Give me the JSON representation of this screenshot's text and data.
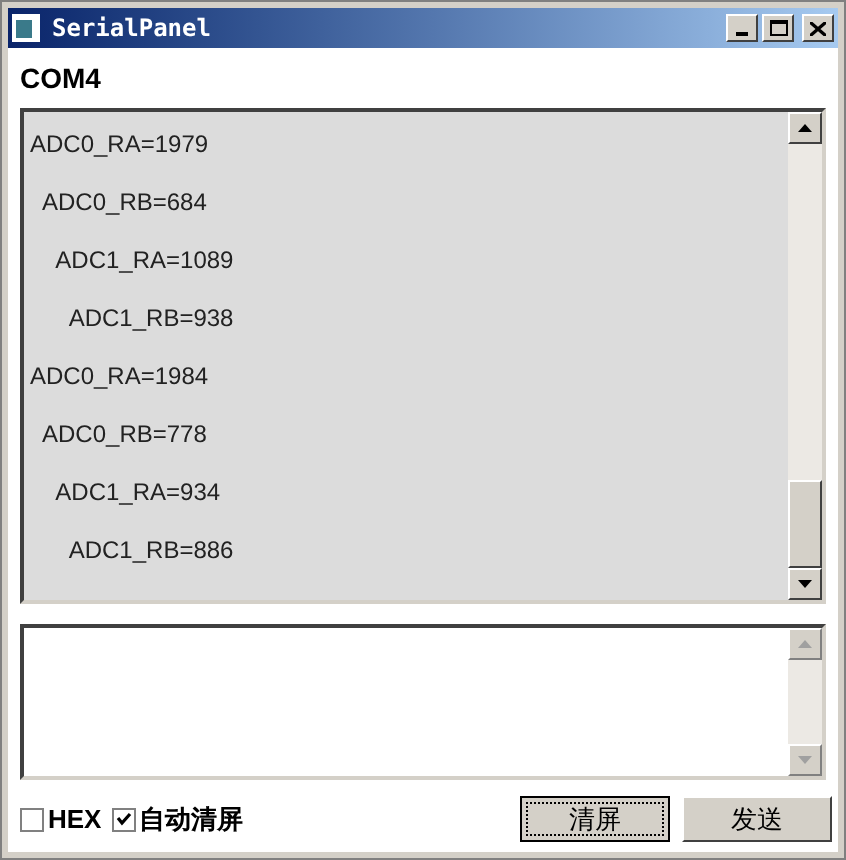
{
  "window": {
    "title": "SerialPanel"
  },
  "port": "COM4",
  "receive_lines": [
    "ADC0_RA=1979",
    "  ADC0_RB=684",
    "    ADC1_RA=1089",
    "      ADC1_RB=938",
    "ADC0_RA=1984",
    "  ADC0_RB=778",
    "    ADC1_RA=934",
    "      ADC1_RB=886"
  ],
  "options": [
    {
      "label": "HEX",
      "checked": false
    },
    {
      "label": "自动清屏",
      "checked": true
    }
  ],
  "buttons": [
    {
      "label": "清屏",
      "focused": true
    },
    {
      "label": "发送",
      "focused": false
    }
  ]
}
